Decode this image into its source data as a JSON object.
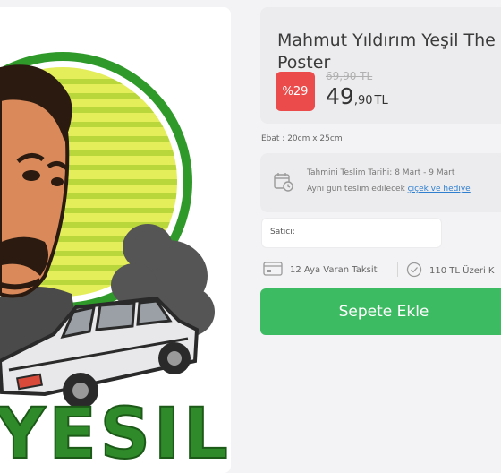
{
  "product": {
    "title_line1": "Mahmut Yıldırım Yeşil The",
    "title_line2": "Poster",
    "brand_text": "YESIL",
    "discount_badge": "%29",
    "old_price": "69,90 TL",
    "new_price_int": "49",
    "new_price_dec": ",90",
    "new_price_currency": "TL",
    "size": "Ebat : 20cm x 25cm"
  },
  "delivery": {
    "estimate_label": "Tahmini Teslim Tarihi:",
    "estimate_value": "8 Mart - 9 Mart",
    "same_day_text": "Aynı gün teslim edilecek",
    "same_day_link": "çiçek ve hediye"
  },
  "seller": {
    "label": "Satıcı:"
  },
  "features": {
    "installment": "12 Aya Varan Taksit",
    "free_shipping": "110 TL Üzeri K"
  },
  "actions": {
    "add_to_cart": "Sepete Ekle"
  },
  "colors": {
    "add_to_cart_bg": "#3dbb62",
    "discount_bg": "#ec4b4b",
    "brand_green": "#2f8a2a",
    "link_blue": "#2f7fd0"
  },
  "icons": {
    "delivery": "calendar-clock-icon",
    "installment": "credit-card-icon",
    "free_shipping": "check-circle-icon"
  }
}
